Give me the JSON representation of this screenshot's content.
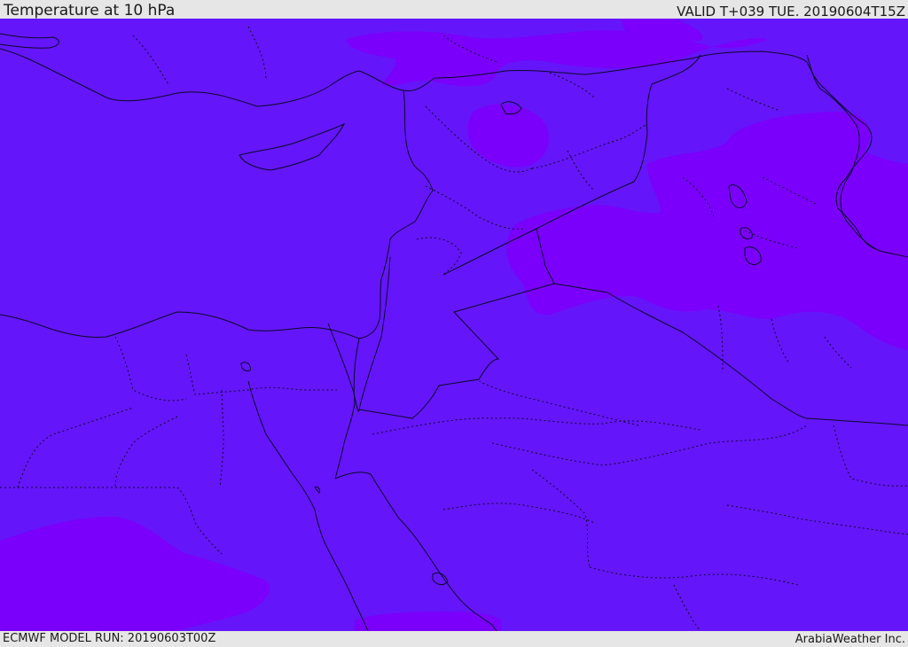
{
  "header": {
    "title": "Temperature at 10 hPa",
    "valid_time": "VALID T+039 TUE. 20190604T15Z"
  },
  "map": {
    "field": "temperature",
    "colors": {
      "ocean_and_land_fill": "#6515f9",
      "warm_contour_fill": "#7a00fb",
      "boundary_lines": "#0a0a2a"
    }
  },
  "footer": {
    "model_run": "ECMWF MODEL RUN: 20190603T00Z",
    "credit": "ArabiaWeather Inc."
  }
}
